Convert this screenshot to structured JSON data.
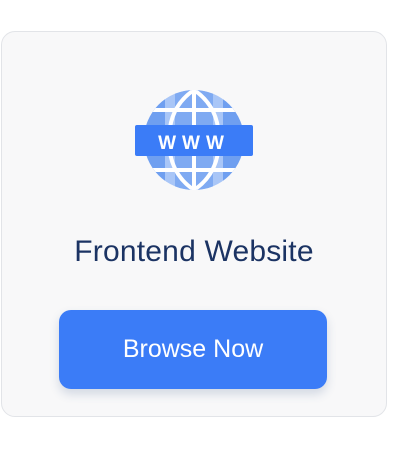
{
  "card": {
    "icon": "globe-www-icon",
    "icon_text": "WWW",
    "title": "Frontend Website",
    "button_label": "Browse Now"
  },
  "colors": {
    "accent": "#3b7cf7",
    "globe_light": "#a9c6f7",
    "globe_mid": "#6f9ff0",
    "title": "#1b3363",
    "card_bg": "#f8f8f9",
    "card_border": "#e2e4e8"
  }
}
